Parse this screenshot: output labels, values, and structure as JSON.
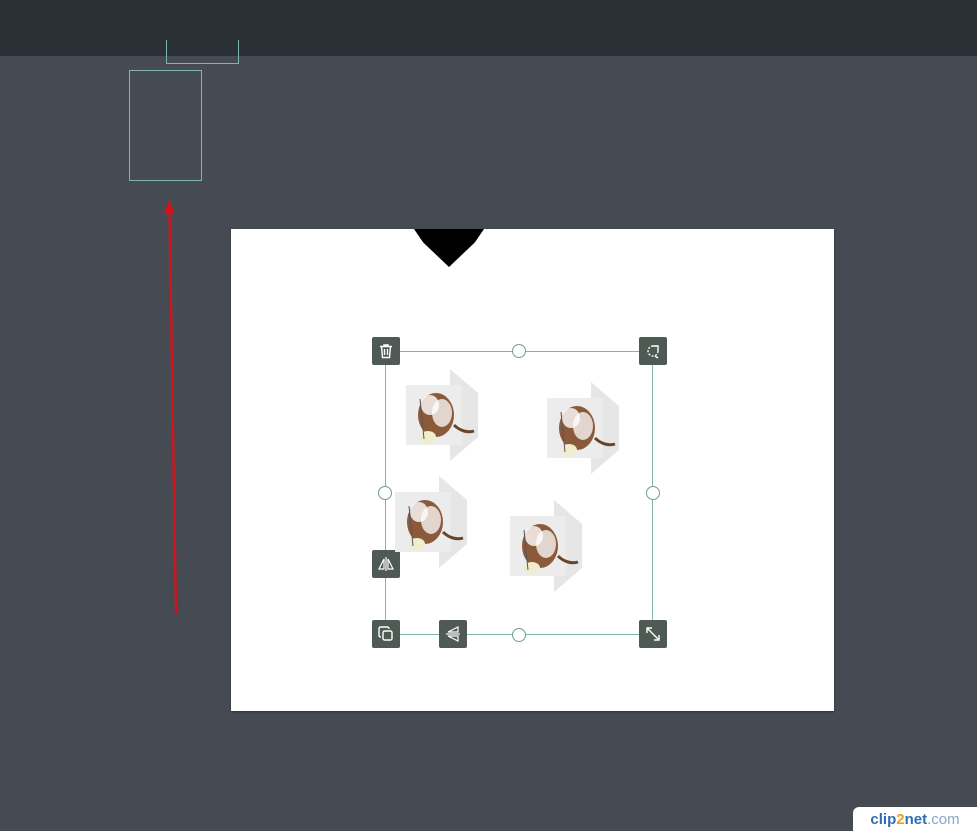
{
  "colors": {
    "workspace_bg": "#464b53",
    "topbar_bg": "#2b2f36",
    "selection_outline": "#7fb7a6",
    "control_bg": "#4f5a55",
    "arrow": "#d0141a"
  },
  "selection": {
    "controls": {
      "delete": "trash-icon",
      "rotate": "rotate-icon",
      "flip_horizontal": "flip-horizontal-icon",
      "duplicate": "duplicate-icon",
      "flip_vertical": "flip-vertical-icon",
      "resize": "resize-icon"
    },
    "items": [
      {
        "name": "cartoon-dog-image-1"
      },
      {
        "name": "cartoon-dog-image-2"
      },
      {
        "name": "cartoon-dog-image-3"
      },
      {
        "name": "cartoon-dog-image-4"
      }
    ]
  },
  "watermark": {
    "part1": "clip",
    "part2": "2",
    "part3": "net",
    "part4": ".com"
  }
}
